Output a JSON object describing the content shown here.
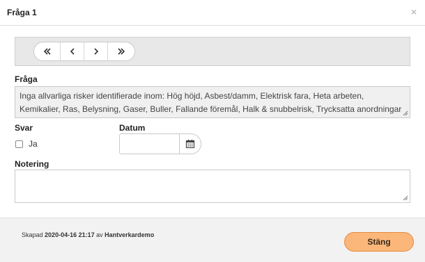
{
  "modal": {
    "title": "Fråga 1",
    "close_symbol": "×"
  },
  "pager": {
    "first_icon": "double-chevron-left-icon",
    "prev_icon": "chevron-left-icon",
    "next_icon": "chevron-right-icon",
    "last_icon": "double-chevron-right-icon"
  },
  "question": {
    "label": "Fråga",
    "text": "Inga allvarliga risker identifierade inom: Hög höjd, Asbest/damm, Elektrisk fara, Heta arbeten, Kemikalier, Ras, Belysning, Gaser, Buller, Fallande föremål, Halk & snubbelrisk, Trycksatta anordningar"
  },
  "answer": {
    "label": "Svar",
    "option_label": "Ja",
    "checked": false
  },
  "date": {
    "label": "Datum",
    "value": "",
    "icon": "calendar-icon"
  },
  "note": {
    "label": "Notering",
    "value": ""
  },
  "footer": {
    "created_prefix": "Skapad",
    "created_date": "2020-04-16 21:17",
    "created_by_word": "av",
    "created_by": "Hantverkardemo",
    "close_label": "Stäng"
  },
  "colors": {
    "close_button_bg": "#fbb77a",
    "close_button_border": "#e58a3c",
    "nav_bar_bg": "#e8e8e8",
    "footer_bg": "#f2f2f2"
  }
}
